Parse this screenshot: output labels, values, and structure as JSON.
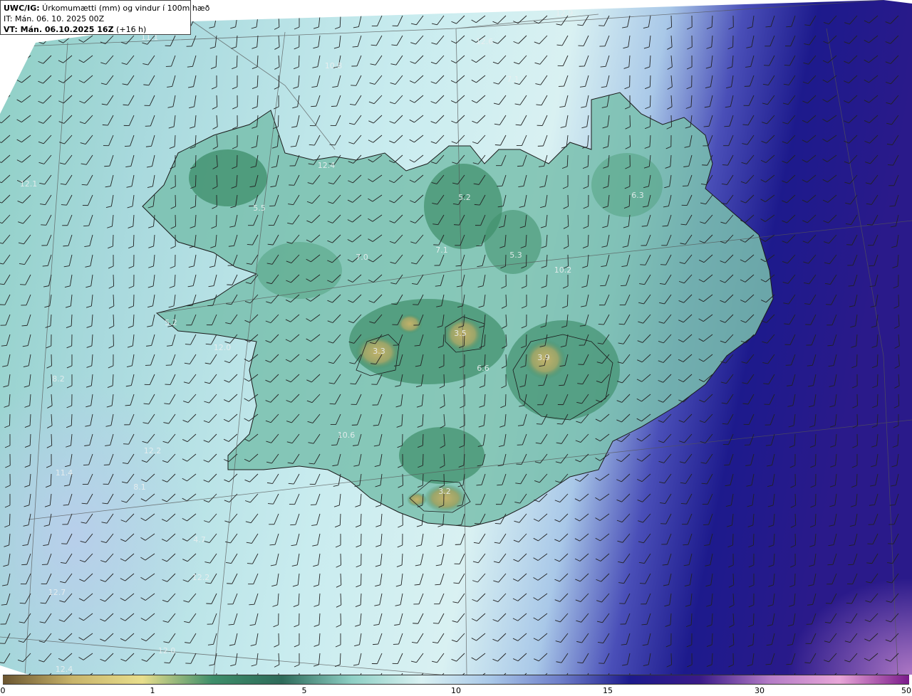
{
  "header": {
    "title_bold": "UWC/IG:",
    "title_rest": " Úrkomumætti (mm) og vindur í 100m hæð",
    "initial_time": "IT: Mán. 06. 10. 2025 00Z",
    "valid_time_bold": "VT: Mán. 06.10.2025 16Z",
    "valid_time_offset": " (+16 h)"
  },
  "colors": {
    "land_outline": "#1a1a1a",
    "grid_line": "#555555",
    "wind_barb": "#222222",
    "scale": [
      "#6b5530",
      "#c8b46a",
      "#e8de8c",
      "#3e8e6a",
      "#2e6b5a",
      "#8ecfc4",
      "#d9f1f2",
      "#a9c8e8",
      "#6e7ec9",
      "#1d1a8c",
      "#3a1a88",
      "#b47cc7",
      "#e8a6d8",
      "#7a1a8a"
    ]
  },
  "colorbar": {
    "ticks": [
      {
        "label": "0",
        "value": 0
      },
      {
        "label": "1",
        "value": 1
      },
      {
        "label": "5",
        "value": 5
      },
      {
        "label": "10",
        "value": 10
      },
      {
        "label": "15",
        "value": 15
      },
      {
        "label": "30",
        "value": 30
      },
      {
        "label": "50",
        "value": 50
      }
    ]
  },
  "value_labels": [
    {
      "text": "12.9"
    },
    {
      "text": "11.1"
    },
    {
      "text": "12.6"
    },
    {
      "text": "10.8"
    },
    {
      "text": "7.1"
    },
    {
      "text": "12.1"
    },
    {
      "text": "12.4"
    },
    {
      "text": "5.5"
    },
    {
      "text": "5.2"
    },
    {
      "text": "6.3"
    },
    {
      "text": "5.3"
    },
    {
      "text": "10.2"
    },
    {
      "text": "7.1"
    },
    {
      "text": "7.0"
    },
    {
      "text": "5.2"
    },
    {
      "text": "3.5"
    },
    {
      "text": "3.3"
    },
    {
      "text": "3.9"
    },
    {
      "text": "12.0"
    },
    {
      "text": "8.2"
    },
    {
      "text": "10.6"
    },
    {
      "text": "12.2"
    },
    {
      "text": "11.4"
    },
    {
      "text": "8.1"
    },
    {
      "text": "3.2"
    },
    {
      "text": "4.7"
    },
    {
      "text": "12.2"
    },
    {
      "text": "12.7"
    },
    {
      "text": "12.0"
    },
    {
      "text": "12.4"
    },
    {
      "text": "6.6"
    }
  ]
}
